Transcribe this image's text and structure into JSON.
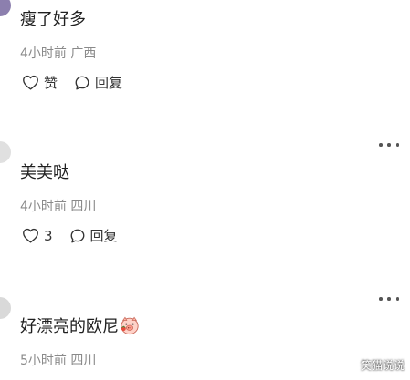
{
  "comments": [
    {
      "text": "瘦了好多",
      "meta": "4小时前 广西",
      "like_label": "赞",
      "reply_label": "回复"
    },
    {
      "text": "美美哒",
      "meta": "4小时前 四川",
      "like_label": "3",
      "reply_label": "回复"
    },
    {
      "text": "好漂亮的欧尼",
      "emoji_icon": "pig-face-emoji",
      "meta": "5小时前 四川"
    }
  ],
  "watermark": "笑猫说说"
}
